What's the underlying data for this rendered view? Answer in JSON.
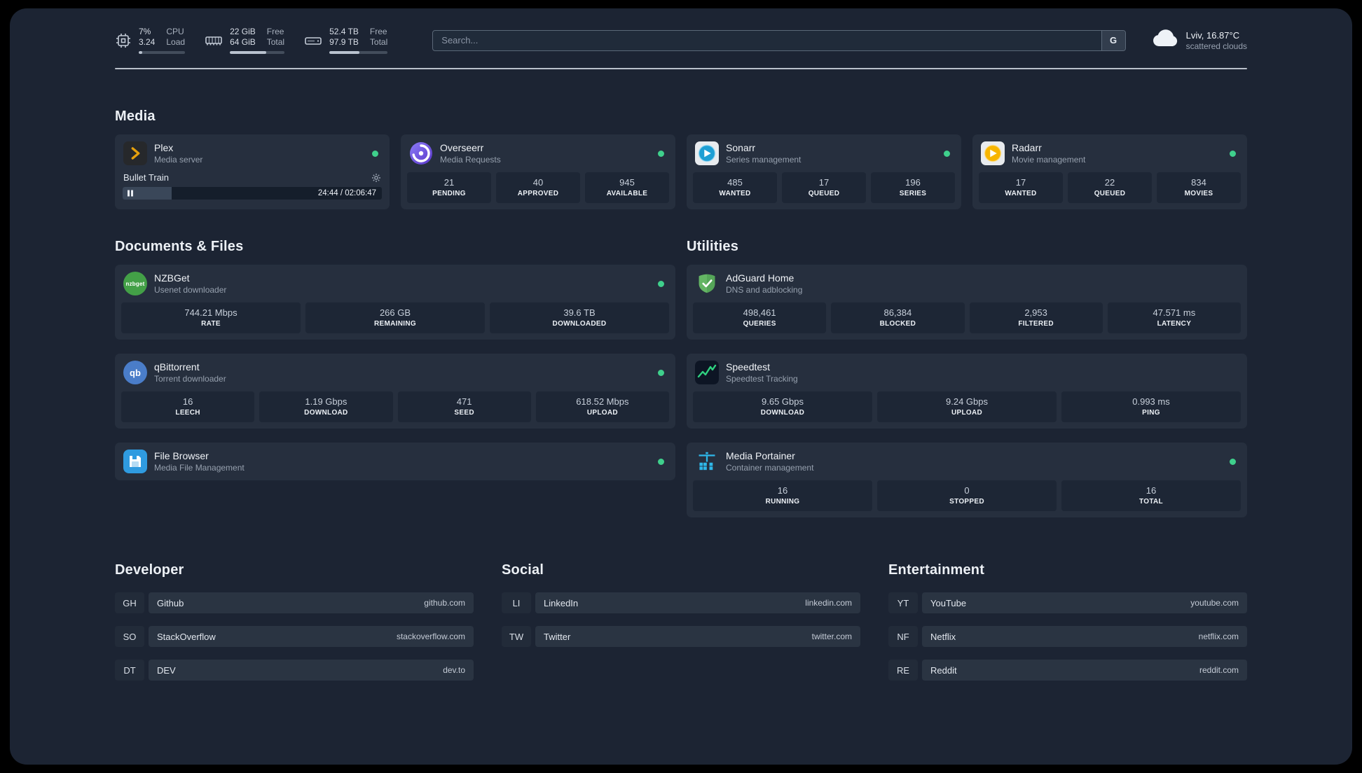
{
  "topbar": {
    "cpu": {
      "value_top": "7%",
      "value_bottom": "3.24",
      "label_top": "CPU",
      "label_bottom": "Load",
      "progress": 8
    },
    "memory": {
      "value_top": "22 GiB",
      "value_bottom": "64 GiB",
      "label_top": "Free",
      "label_bottom": "Total",
      "progress": 66
    },
    "disk": {
      "value_top": "52.4 TB",
      "value_bottom": "97.9 TB",
      "label_top": "Free",
      "label_bottom": "Total",
      "progress": 52
    },
    "search": {
      "placeholder": "Search...",
      "provider_label": "G"
    },
    "weather": {
      "location": "Lviv, 16.87°C",
      "condition": "scattered clouds"
    }
  },
  "section_titles": {
    "media": "Media",
    "documents": "Documents & Files",
    "utilities": "Utilities",
    "developer": "Developer",
    "social": "Social",
    "entertainment": "Entertainment"
  },
  "services": {
    "plex": {
      "name": "Plex",
      "description": "Media server",
      "player": {
        "title": "Bullet Train",
        "time": "24:44 / 02:06:47",
        "progress": 19
      }
    },
    "overseerr": {
      "name": "Overseerr",
      "description": "Media Requests",
      "stats": [
        {
          "value": "21",
          "label": "PENDING"
        },
        {
          "value": "40",
          "label": "APPROVED"
        },
        {
          "value": "945",
          "label": "AVAILABLE"
        }
      ]
    },
    "sonarr": {
      "name": "Sonarr",
      "description": "Series management",
      "stats": [
        {
          "value": "485",
          "label": "WANTED"
        },
        {
          "value": "17",
          "label": "QUEUED"
        },
        {
          "value": "196",
          "label": "SERIES"
        }
      ]
    },
    "radarr": {
      "name": "Radarr",
      "description": "Movie management",
      "stats": [
        {
          "value": "17",
          "label": "WANTED"
        },
        {
          "value": "22",
          "label": "QUEUED"
        },
        {
          "value": "834",
          "label": "MOVIES"
        }
      ]
    },
    "nzbget": {
      "name": "NZBGet",
      "description": "Usenet downloader",
      "icon_text": "nzbget",
      "stats": [
        {
          "value": "744.21 Mbps",
          "label": "RATE"
        },
        {
          "value": "266 GB",
          "label": "REMAINING"
        },
        {
          "value": "39.6 TB",
          "label": "DOWNLOADED"
        }
      ]
    },
    "qbittorrent": {
      "name": "qBittorrent",
      "description": "Torrent downloader",
      "icon_text": "qb",
      "stats": [
        {
          "value": "16",
          "label": "LEECH"
        },
        {
          "value": "1.19 Gbps",
          "label": "DOWNLOAD"
        },
        {
          "value": "471",
          "label": "SEED"
        },
        {
          "value": "618.52 Mbps",
          "label": "UPLOAD"
        }
      ]
    },
    "filebrowser": {
      "name": "File Browser",
      "description": "Media File Management"
    },
    "adguard": {
      "name": "AdGuard Home",
      "description": "DNS and adblocking",
      "stats": [
        {
          "value": "498,461",
          "label": "QUERIES"
        },
        {
          "value": "86,384",
          "label": "BLOCKED"
        },
        {
          "value": "2,953",
          "label": "FILTERED"
        },
        {
          "value": "47.571 ms",
          "label": "LATENCY"
        }
      ]
    },
    "speedtest": {
      "name": "Speedtest",
      "description": "Speedtest Tracking",
      "stats": [
        {
          "value": "9.65 Gbps",
          "label": "DOWNLOAD"
        },
        {
          "value": "9.24 Gbps",
          "label": "UPLOAD"
        },
        {
          "value": "0.993 ms",
          "label": "PING"
        }
      ]
    },
    "portainer": {
      "name": "Media Portainer",
      "description": "Container management",
      "stats": [
        {
          "value": "16",
          "label": "RUNNING"
        },
        {
          "value": "0",
          "label": "STOPPED"
        },
        {
          "value": "16",
          "label": "TOTAL"
        }
      ]
    }
  },
  "bookmarks": {
    "developer": [
      {
        "abbr": "GH",
        "name": "Github",
        "url": "github.com"
      },
      {
        "abbr": "SO",
        "name": "StackOverflow",
        "url": "stackoverflow.com"
      },
      {
        "abbr": "DT",
        "name": "DEV",
        "url": "dev.to"
      }
    ],
    "social": [
      {
        "abbr": "LI",
        "name": "LinkedIn",
        "url": "linkedin.com"
      },
      {
        "abbr": "TW",
        "name": "Twitter",
        "url": "twitter.com"
      }
    ],
    "entertainment": [
      {
        "abbr": "YT",
        "name": "YouTube",
        "url": "youtube.com"
      },
      {
        "abbr": "NF",
        "name": "Netflix",
        "url": "netflix.com"
      },
      {
        "abbr": "RE",
        "name": "Reddit",
        "url": "reddit.com"
      }
    ]
  },
  "colors": {
    "status_online": "#3fd08c"
  }
}
